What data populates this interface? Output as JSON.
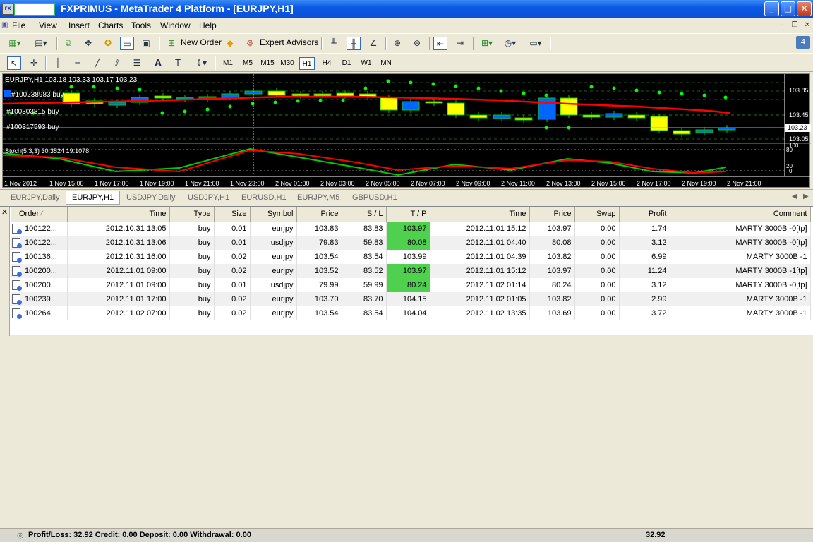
{
  "window": {
    "title": "FXPRIMUS - MetaTrader 4 Platform - [EURJPY,H1]",
    "min": "_",
    "max": "□",
    "close": "✕"
  },
  "menu": [
    "File",
    "View",
    "Insert",
    "Charts",
    "Tools",
    "Window",
    "Help"
  ],
  "toolbar": {
    "new_order": "New Order",
    "expert_advisors": "Expert Advisors",
    "badge": "4"
  },
  "timeframes": [
    "M1",
    "M5",
    "M15",
    "M30",
    "H1",
    "H4",
    "D1",
    "W1",
    "MN"
  ],
  "active_timeframe": "H1",
  "chart": {
    "header": "EURJPY,H1  103.18  103.33  103.17  103.23",
    "order_labels": [
      "#100238983 buy",
      "#100303815 buy",
      "#100317593 buy"
    ],
    "price_labels": [
      "103.85",
      "103.45",
      "103.23",
      "103.05"
    ],
    "current_price": "103.23",
    "stoch_label": "Stoch(5,3,3) 30.3524 19.1078",
    "stoch_scale": [
      "100",
      "80",
      "20",
      "0"
    ],
    "time_labels": [
      "1 Nov 2012",
      "1 Nov 15:00",
      "1 Nov 17:00",
      "1 Nov 19:00",
      "1 Nov 21:00",
      "1 Nov 23:00",
      "2 Nov 01:00",
      "2 Nov 03:00",
      "2 Nov 05:00",
      "2 Nov 07:00",
      "2 Nov 09:00",
      "2 Nov 11:00",
      "2 Nov 13:00",
      "2 Nov 15:00",
      "2 Nov 17:00",
      "2 Nov 19:00",
      "2 Nov 21:00"
    ],
    "colors": {
      "bull": "#0066ff",
      "bear": "#ffff00",
      "ma": "#ff0000",
      "stoch_main": "#00cc00",
      "stoch_signal": "#ff0000",
      "dots": "#00ff00"
    }
  },
  "chart_tabs": [
    "EURJPY,Daily",
    "EURJPY,H1",
    "USDJPY,Daily",
    "USDJPY,H1",
    "EURUSD,H1",
    "EURJPY,M5",
    "GBPUSD,H1"
  ],
  "active_chart_tab": "EURJPY,H1",
  "terminal": {
    "columns": [
      "Order",
      "Time",
      "Type",
      "Size",
      "Symbol",
      "Price",
      "S / L",
      "T / P",
      "Time",
      "Price",
      "Swap",
      "Profit",
      "Comment"
    ],
    "rows": [
      {
        "order": "100122...",
        "open_time": "2012.10.31 13:05",
        "type": "buy",
        "size": "0.01",
        "symbol": "eurjpy",
        "price": "103.83",
        "sl": "83.83",
        "tp": "103.97",
        "tp_hit": true,
        "close_time": "2012.11.01 15:12",
        "close_price": "103.97",
        "swap": "0.00",
        "profit": "1.74",
        "comment": "MARTY 3000B -0[tp]"
      },
      {
        "order": "100122...",
        "open_time": "2012.10.31 13:06",
        "type": "buy",
        "size": "0.01",
        "symbol": "usdjpy",
        "price": "79.83",
        "sl": "59.83",
        "tp": "80.08",
        "tp_hit": true,
        "close_time": "2012.11.01 04:40",
        "close_price": "80.08",
        "swap": "0.00",
        "profit": "3.12",
        "comment": "MARTY 3000B -0[tp]"
      },
      {
        "order": "100136...",
        "open_time": "2012.10.31 16:00",
        "type": "buy",
        "size": "0.02",
        "symbol": "eurjpy",
        "price": "103.54",
        "sl": "83.54",
        "tp": "103.99",
        "tp_hit": false,
        "close_time": "2012.11.01 04:39",
        "close_price": "103.82",
        "swap": "0.00",
        "profit": "6.99",
        "comment": "MARTY 3000B -1"
      },
      {
        "order": "100200...",
        "open_time": "2012.11.01 09:00",
        "type": "buy",
        "size": "0.02",
        "symbol": "eurjpy",
        "price": "103.52",
        "sl": "83.52",
        "tp": "103.97",
        "tp_hit": true,
        "close_time": "2012.11.01 15:12",
        "close_price": "103.97",
        "swap": "0.00",
        "profit": "11.24",
        "comment": "MARTY 3000B -1[tp]"
      },
      {
        "order": "100200...",
        "open_time": "2012.11.01 09:00",
        "type": "buy",
        "size": "0.01",
        "symbol": "usdjpy",
        "price": "79.99",
        "sl": "59.99",
        "tp": "80.24",
        "tp_hit": true,
        "close_time": "2012.11.02 01:14",
        "close_price": "80.24",
        "swap": "0.00",
        "profit": "3.12",
        "comment": "MARTY 3000B -0[tp]"
      },
      {
        "order": "100239...",
        "open_time": "2012.11.01 17:00",
        "type": "buy",
        "size": "0.02",
        "symbol": "eurjpy",
        "price": "103.70",
        "sl": "83.70",
        "tp": "104.15",
        "tp_hit": false,
        "close_time": "2012.11.02 01:05",
        "close_price": "103.82",
        "swap": "0.00",
        "profit": "2.99",
        "comment": "MARTY 3000B -1"
      },
      {
        "order": "100264...",
        "open_time": "2012.11.02 07:00",
        "type": "buy",
        "size": "0.02",
        "symbol": "eurjpy",
        "price": "103.54",
        "sl": "83.54",
        "tp": "104.04",
        "tp_hit": false,
        "close_time": "2012.11.02 13:35",
        "close_price": "103.69",
        "swap": "0.00",
        "profit": "3.72",
        "comment": "MARTY 3000B -1"
      }
    ],
    "summary": "Profit/Loss: 32.92  Credit: 0.00  Deposit: 0.00  Withdrawal: 0.00",
    "summary_total": "32.92"
  }
}
